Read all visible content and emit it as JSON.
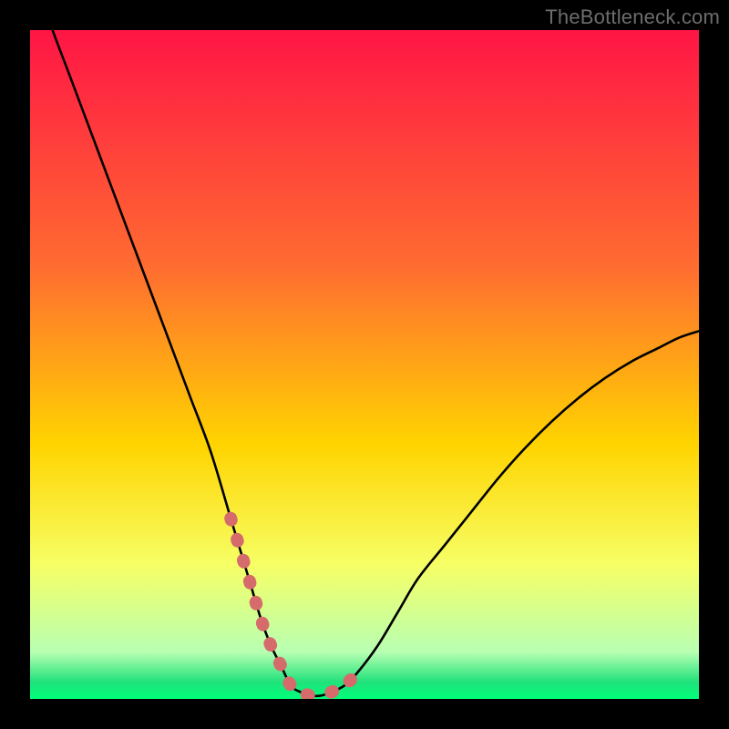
{
  "watermark": "TheBottleneck.com",
  "colors": {
    "black": "#000000",
    "curve": "#000000",
    "accent_pink": "#d66b6c",
    "grad_top": "#ff1545",
    "grad_mid_upper": "#ff6b31",
    "grad_mid": "#ffd400",
    "grad_mid_lower": "#f6ff66",
    "grad_green_pale": "#b8ffb2",
    "grad_green": "#20e27b",
    "grad_green_bright": "#00ff7a"
  },
  "chart_data": {
    "type": "line",
    "title": "",
    "xlabel": "",
    "ylabel": "",
    "xlim": [
      0,
      100
    ],
    "ylim": [
      0,
      100
    ],
    "x": [
      0,
      3,
      6,
      9,
      12,
      15,
      18,
      21,
      24,
      27,
      30,
      31.5,
      33,
      34.5,
      36,
      37.5,
      39,
      40.5,
      42,
      43.5,
      45,
      47,
      49,
      52,
      55,
      58,
      62,
      66,
      70,
      74,
      78,
      82,
      86,
      90,
      94,
      97,
      100
    ],
    "values": [
      110,
      101,
      93,
      85,
      77,
      69,
      61,
      53,
      45,
      37,
      27,
      22,
      17,
      12,
      8,
      5,
      2,
      1,
      0.5,
      0.5,
      1,
      2,
      4,
      8,
      13,
      18,
      23,
      28,
      33,
      37.5,
      41.5,
      45,
      48,
      50.5,
      52.5,
      54,
      55
    ],
    "accent_segments": [
      {
        "x": [
          30,
          31.5,
          33,
          34.5,
          36,
          37.5,
          39,
          40.5,
          42,
          43.5
        ],
        "values": [
          27,
          22,
          17,
          12,
          8,
          5,
          2,
          1,
          0.5,
          0.5
        ]
      },
      {
        "x": [
          45,
          47,
          49
        ],
        "values": [
          1,
          2,
          4
        ]
      }
    ],
    "gradient_stops": [
      {
        "offset": 0.0,
        "color_key": "grad_top"
      },
      {
        "offset": 0.35,
        "color_key": "grad_mid_upper"
      },
      {
        "offset": 0.62,
        "color_key": "grad_mid"
      },
      {
        "offset": 0.8,
        "color_key": "grad_mid_lower"
      },
      {
        "offset": 0.93,
        "color_key": "grad_green_pale"
      },
      {
        "offset": 0.975,
        "color_key": "grad_green"
      },
      {
        "offset": 1.0,
        "color_key": "grad_green_bright"
      }
    ]
  }
}
